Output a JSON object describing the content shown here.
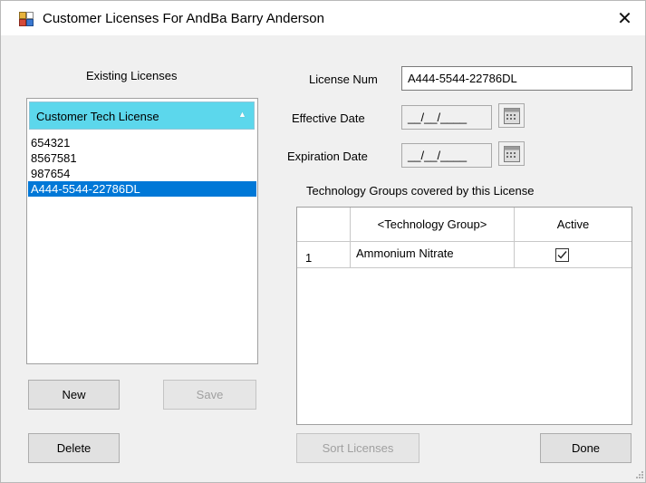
{
  "window": {
    "title": "Customer Licenses For AndBa Barry Anderson",
    "close_glyph": "✕"
  },
  "existing": {
    "heading": "Existing Licenses",
    "column_header": "Customer Tech License",
    "sort_icon": "sort-ascending-icon",
    "items": [
      "654321",
      "8567581",
      "987654",
      "A444-5544-22786DL"
    ],
    "selected_index": 3
  },
  "form": {
    "license_num_label": "License Num",
    "license_num_value": "A444-5544-22786DL",
    "effective_label": "Effective Date",
    "effective_value": "__/__/____",
    "expiration_label": "Expiration Date",
    "expiration_value": "__/__/____"
  },
  "tech": {
    "heading": "Technology Groups covered by this License",
    "columns": [
      "",
      "<Technology Group>",
      "Active"
    ],
    "rows": [
      {
        "num": "1",
        "group": "Ammonium Nitrate",
        "active": true
      }
    ]
  },
  "buttons": {
    "new": "New",
    "save": "Save",
    "delete": "Delete",
    "sort": "Sort Licenses",
    "done": "Done"
  },
  "colors": {
    "header_bg": "#5cd7ec",
    "selected_bg": "#0078d7"
  }
}
